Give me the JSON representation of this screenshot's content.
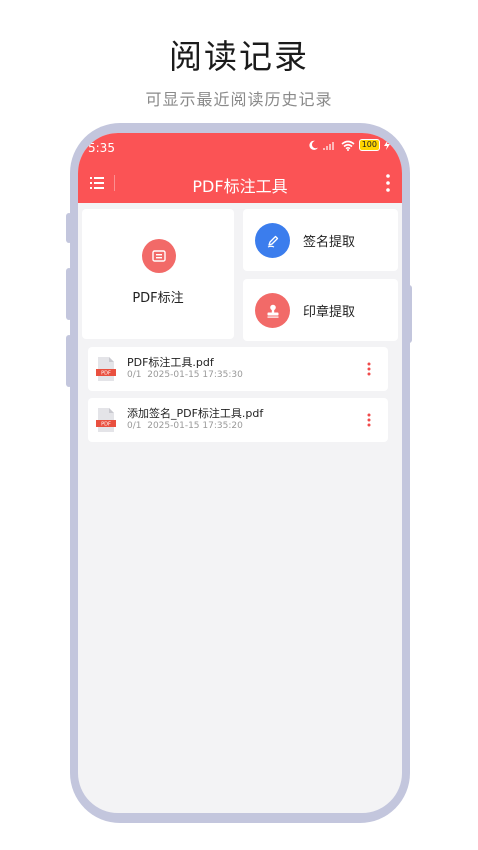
{
  "promo": {
    "title": "阅读记录",
    "subtitle": "可显示最近阅读历史记录"
  },
  "status_bar": {
    "time": "5:35",
    "battery": "100"
  },
  "app_bar": {
    "title": "PDF标注工具"
  },
  "tools": {
    "annotate_label": "PDF标注",
    "signature_label": "签名提取",
    "stamp_label": "印章提取"
  },
  "files": [
    {
      "name": "PDF标注工具.pdf",
      "pages": "0/1",
      "time": "2025-01-15 17:35:30",
      "badge": "PDF"
    },
    {
      "name": "添加签名_PDF标注工具.pdf",
      "pages": "0/1",
      "time": "2025-01-15 17:35:20",
      "badge": "PDF"
    }
  ],
  "colors": {
    "brand_red": "#fb5355",
    "signature_blue": "#3b7ded",
    "stamp_red": "#f26a68"
  }
}
